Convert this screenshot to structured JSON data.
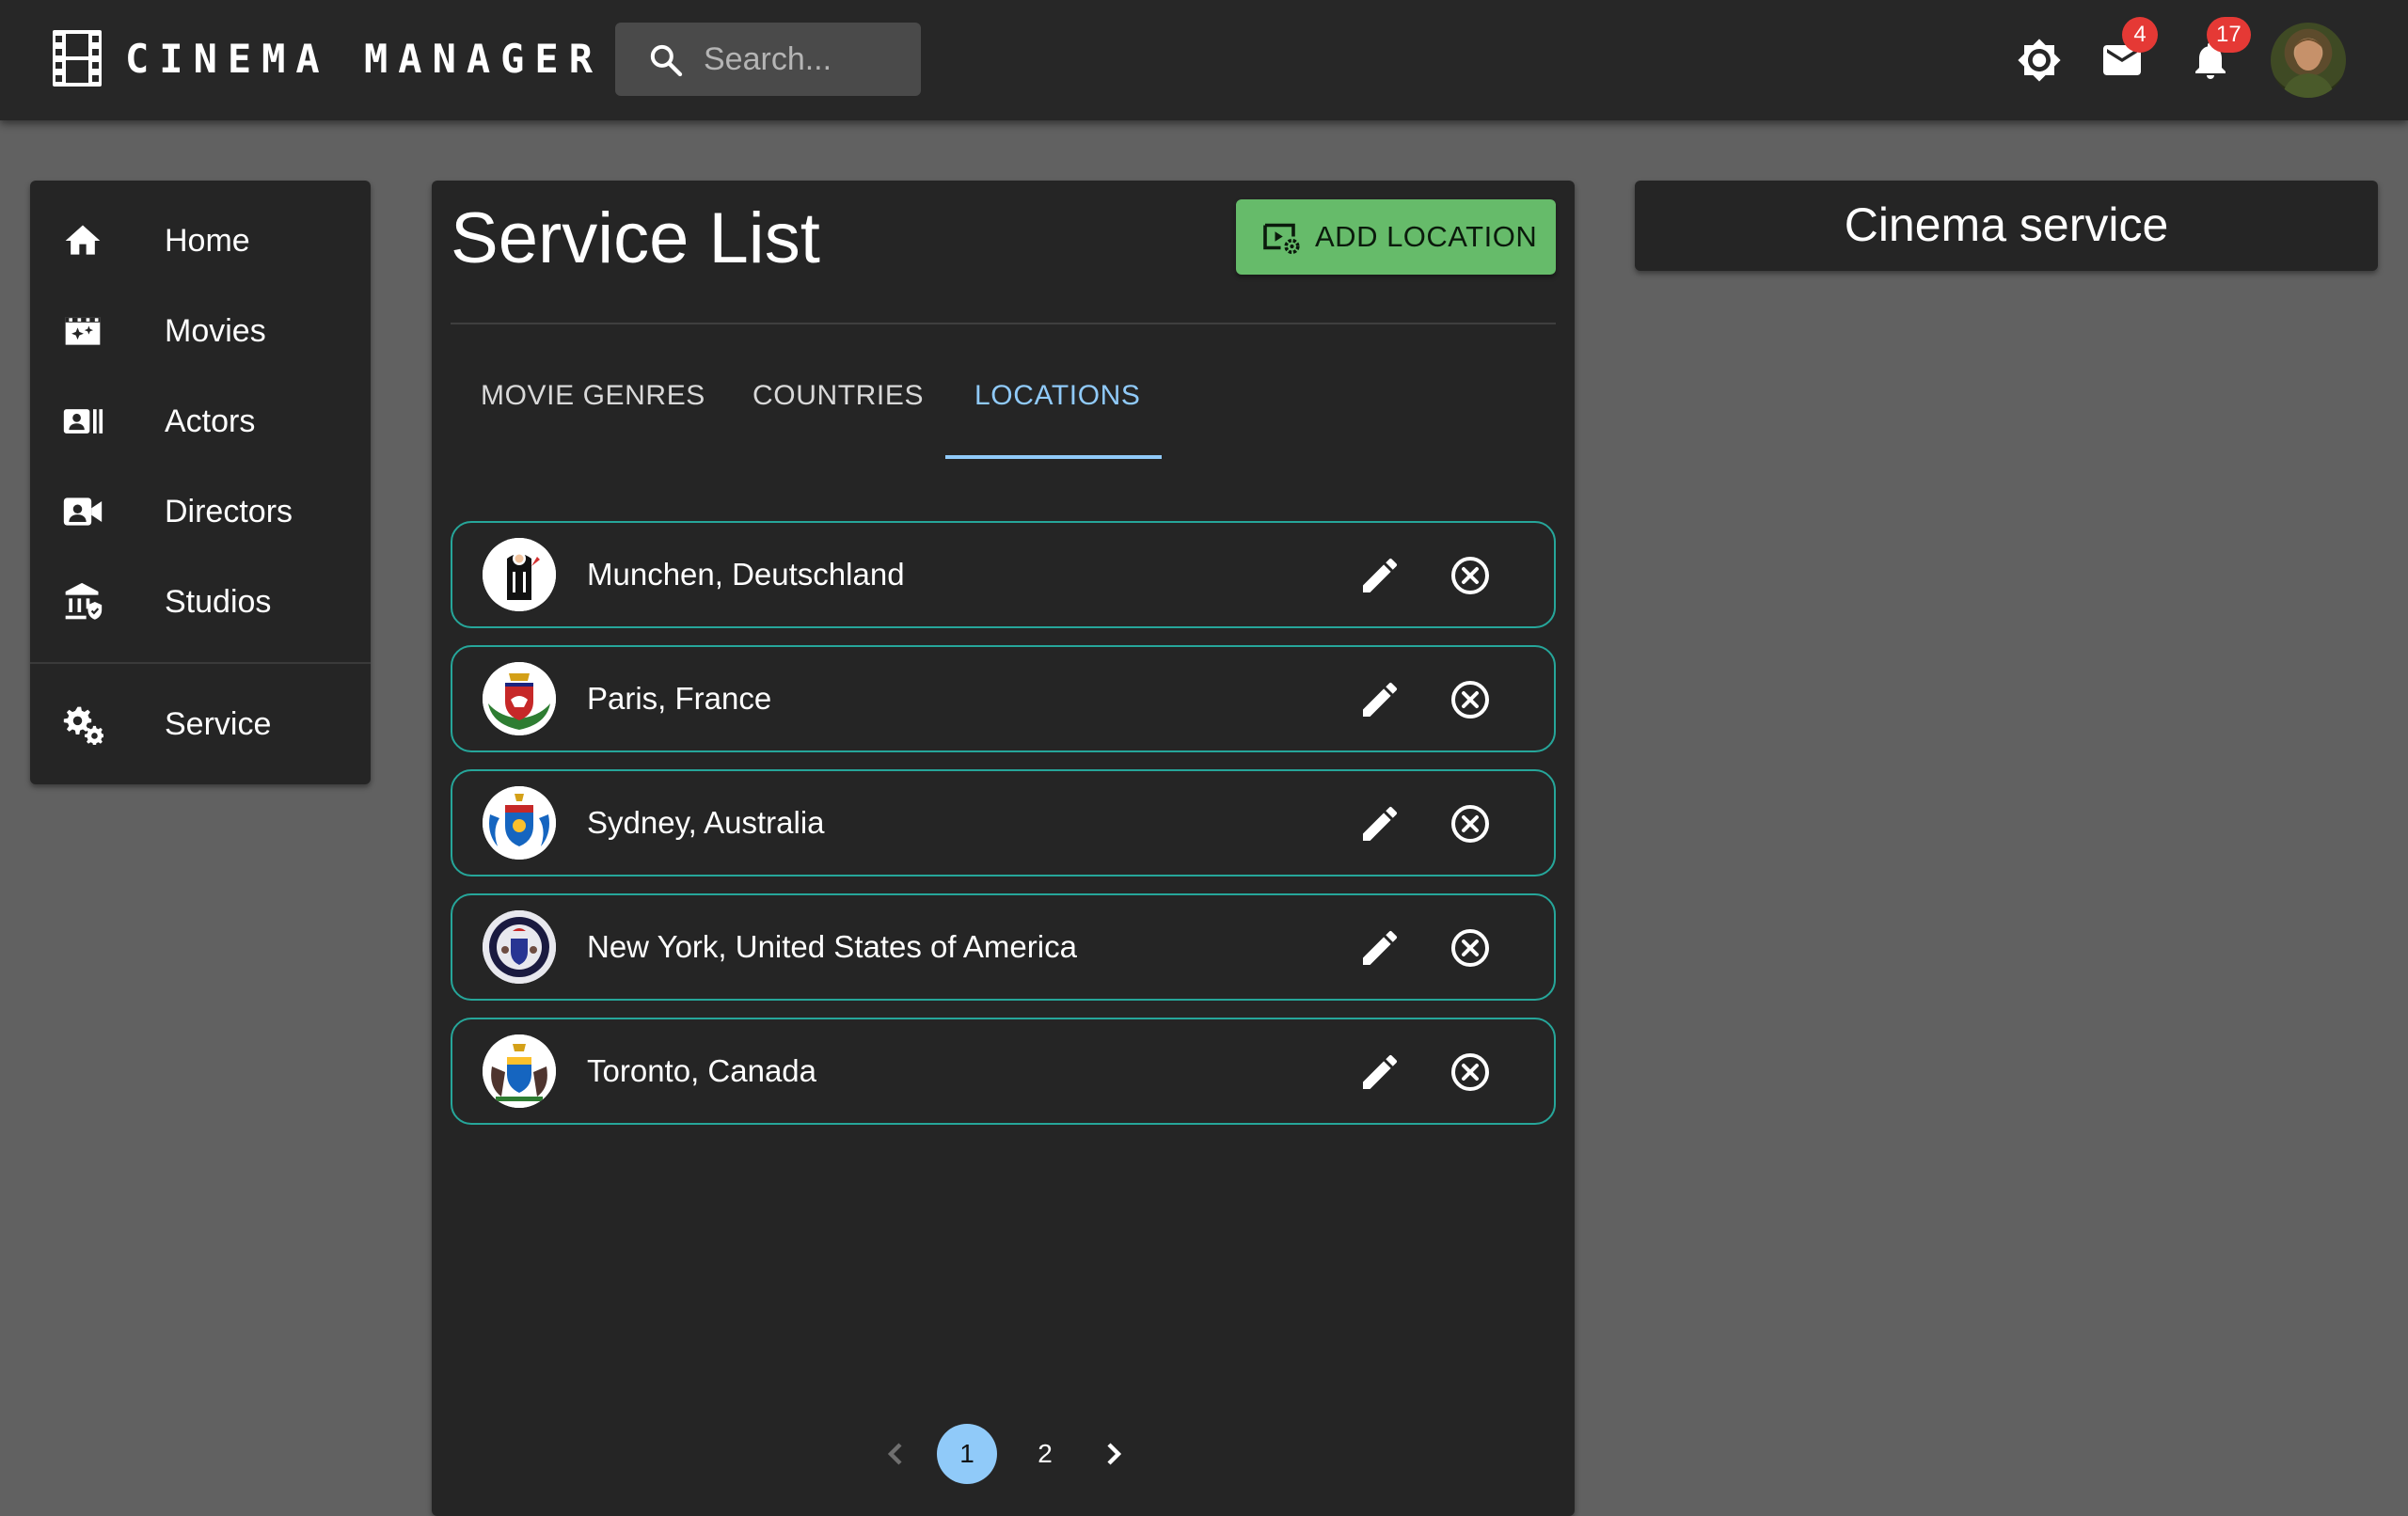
{
  "app": {
    "title": "CINEMA MANAGER",
    "search_placeholder": "Search...",
    "mail_count": "4",
    "notification_count": "17",
    "icons": [
      "film-strip-icon",
      "search-icon",
      "brightness-icon",
      "mail-icon",
      "bell-icon"
    ]
  },
  "sidebar": {
    "items": [
      {
        "label": "Home",
        "icon": "home-icon"
      },
      {
        "label": "Movies",
        "icon": "movie-icon"
      },
      {
        "label": "Actors",
        "icon": "badge-icon"
      },
      {
        "label": "Directors",
        "icon": "video-camera-icon"
      },
      {
        "label": "Studios",
        "icon": "bank-icon"
      },
      {
        "label": "Service",
        "icon": "gears-icon"
      }
    ]
  },
  "main": {
    "title": "Service List",
    "add_button": "ADD LOCATION",
    "tabs": [
      {
        "label": "MOVIE GENRES"
      },
      {
        "label": "COUNTRIES"
      },
      {
        "label": "LOCATIONS",
        "active": true
      }
    ],
    "locations": [
      {
        "name": "Munchen, Deutschland"
      },
      {
        "name": "Paris, France"
      },
      {
        "name": "Sydney, Australia"
      },
      {
        "name": "New York, United States of America"
      },
      {
        "name": "Toronto, Canada"
      }
    ],
    "pagination": {
      "pages": [
        "1",
        "2"
      ],
      "current": "1"
    }
  },
  "side_card": {
    "title": "Cinema service"
  },
  "colors": {
    "background": "#616161",
    "surface": "#252525",
    "accent": "#90caf9",
    "add_button": "#66bb6a",
    "row_border": "#26a69a",
    "badge": "#e53935"
  }
}
